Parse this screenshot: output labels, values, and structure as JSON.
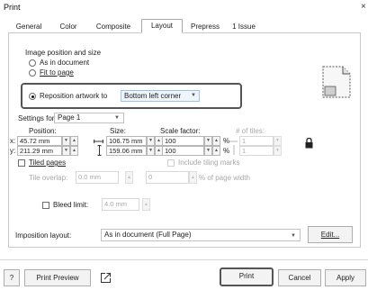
{
  "window": {
    "title": "Print",
    "close_glyph": "×"
  },
  "tabs": [
    {
      "label": "General",
      "active": false
    },
    {
      "label": "Color",
      "active": false
    },
    {
      "label": "Composite",
      "active": false
    },
    {
      "label": "Layout",
      "active": true
    },
    {
      "label": "Prepress",
      "active": false
    },
    {
      "label": "1 Issue",
      "active": false
    }
  ],
  "position_group": {
    "title": "Image position and size",
    "options": [
      {
        "label": "As in document",
        "selected": false
      },
      {
        "label": "Fit to page",
        "selected": false
      },
      {
        "label": "Reposition artwork to",
        "selected": true
      }
    ],
    "reposition_value": "Bottom left corner"
  },
  "settings": {
    "settings_for_label": "Settings for:",
    "settings_for_value": "Page 1",
    "position_label": "Position:",
    "size_label": "Size:",
    "scale_label": "Scale factor:",
    "tiles_label": "# of tiles:",
    "x_prefix": "x:",
    "y_prefix": "y:",
    "x_value": "45.72 mm",
    "y_value": "211.29 mm",
    "width_value": "106.75 mm",
    "height_value": "159.06 mm",
    "scale_x": "100",
    "scale_y": "100",
    "percent": "%",
    "tiles_x": "1",
    "tiles_y": "1"
  },
  "tiling": {
    "tiled_pages_label": "Tiled pages",
    "tiled_pages_checked": false,
    "include_marks_label": "Include tiling marks",
    "tile_overlap_label": "Tile overlap:",
    "tile_overlap_value": "0.0 mm",
    "page_width_value": "0",
    "page_width_suffix": "% of page width"
  },
  "bleed": {
    "label": "Bleed limit:",
    "checked": false,
    "value": "4.0 mm"
  },
  "imposition": {
    "label": "Imposition layout:",
    "value": "As in document (Full Page)",
    "edit_label": "Edit..."
  },
  "footer": {
    "help_label": "?",
    "print_preview_label": "Print Preview",
    "print_label": "Print",
    "cancel_label": "Cancel",
    "apply_label": "Apply"
  },
  "icons": {
    "spin_up": "▲",
    "spin_down": "▼",
    "dropdown": "▼"
  },
  "colors": {
    "combo_highlight": "#9ec3e6",
    "callout_border": "#555555"
  }
}
